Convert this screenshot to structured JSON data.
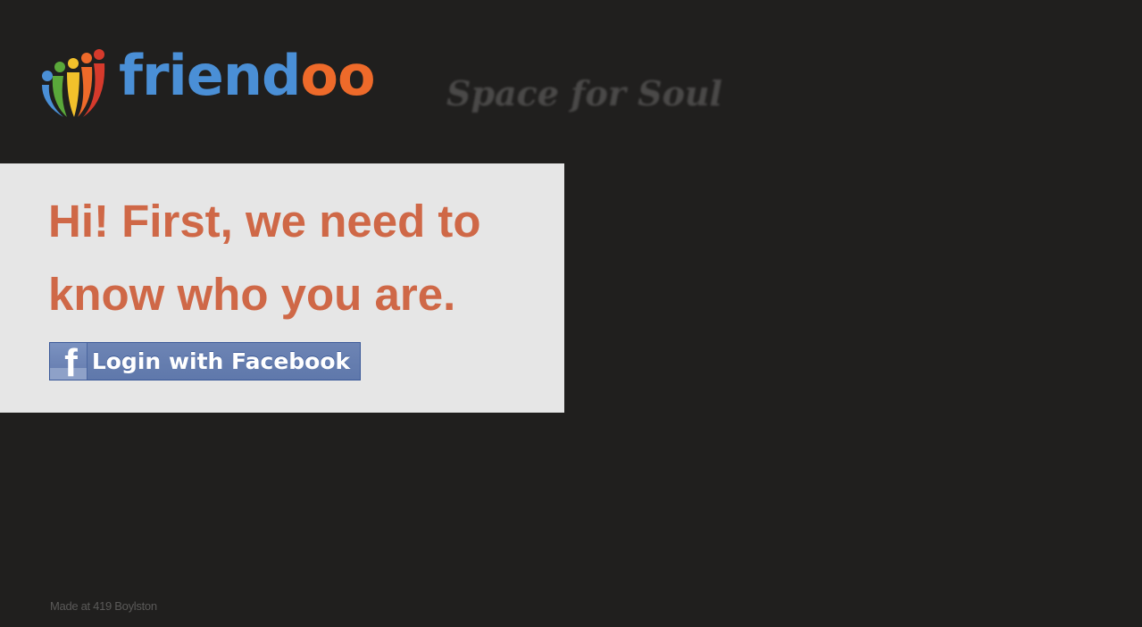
{
  "header": {
    "logo_part1": "frien",
    "logo_part2": "d",
    "logo_part3": "oo",
    "tagline": "Space for Soul"
  },
  "login_panel": {
    "headline": "Hi! First, we need to know who you are.",
    "facebook_button_label": "Login with Facebook",
    "facebook_icon_glyph": "f"
  },
  "footer": {
    "credit": "Made at 419 Boylston"
  },
  "colors": {
    "background": "#201f1e",
    "panel": "#e6e6e6",
    "headline": "#cf6847",
    "facebook_blue": "#6d84b4",
    "logo_blue": "#4a8fd6",
    "logo_orange": "#ee6a2a"
  }
}
